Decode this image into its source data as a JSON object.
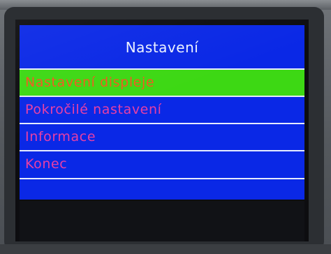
{
  "screen": {
    "title": "Nastavení",
    "menu": [
      {
        "label": "Nastavení displeje",
        "selected": true
      },
      {
        "label": "Pokročilé nastavení",
        "selected": false
      },
      {
        "label": "Informace",
        "selected": false
      },
      {
        "label": "Konec",
        "selected": false
      }
    ],
    "colors": {
      "background": "#0a28e6",
      "selected_background": "#3dd814",
      "item_text": "#e73fa5",
      "selected_text": "#ef5a1f",
      "title_text": "#eef3ff"
    }
  }
}
